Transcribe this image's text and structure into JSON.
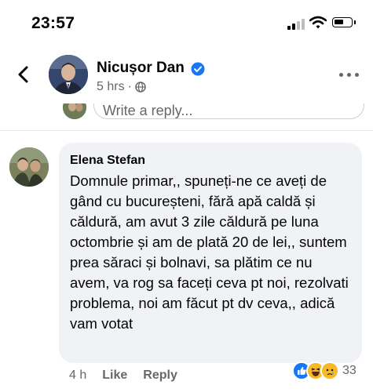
{
  "status_bar": {
    "time": "23:57"
  },
  "post_header": {
    "author": "Nicușor Dan",
    "time_ago": "5 hrs",
    "separator": "·"
  },
  "reply_box": {
    "placeholder": "Write a reply..."
  },
  "comment": {
    "author": "Elena Stefan",
    "text": "Domnule primar,, spuneți-ne ce aveți de gând cu bucureșteni, fără apă caldă și căldură, am avut 3 zile căldură pe luna octombrie și am de plată 20 de lei,, suntem prea săraci și bolnavi, sa plătim ce nu avem, va rog sa faceți ceva pt noi, rezolvati problema, noi am făcut pt dv ceva,, adică vam votat",
    "time_ago": "4 h",
    "like_label": "Like",
    "reply_label": "Reply",
    "reaction_count": "33",
    "reaction_icons": [
      "like-icon",
      "haha-icon",
      "sad-icon"
    ]
  },
  "colors": {
    "verified": "#1877f2",
    "bubble": "#f0f2f5",
    "secondary_text": "#65676b"
  }
}
